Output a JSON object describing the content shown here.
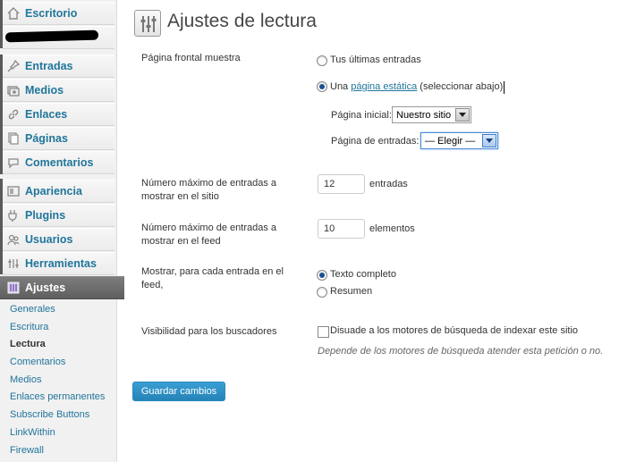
{
  "sidebar": {
    "items": [
      {
        "label": "Escritorio",
        "icon": "dashboard-icon"
      },
      {
        "label": "",
        "icon": "redacted"
      },
      {
        "label": "Entradas",
        "icon": "pin-icon"
      },
      {
        "label": "Medios",
        "icon": "media-icon"
      },
      {
        "label": "Enlaces",
        "icon": "links-icon"
      },
      {
        "label": "Páginas",
        "icon": "pages-icon"
      },
      {
        "label": "Comentarios",
        "icon": "comments-icon"
      },
      {
        "label": "Apariencia",
        "icon": "appearance-icon"
      },
      {
        "label": "Plugins",
        "icon": "plugins-icon"
      },
      {
        "label": "Usuarios",
        "icon": "users-icon"
      },
      {
        "label": "Herramientas",
        "icon": "tools-icon"
      },
      {
        "label": "Ajustes",
        "icon": "settings-icon"
      }
    ],
    "submenu": [
      "Generales",
      "Escritura",
      "Lectura",
      "Comentarios",
      "Medios",
      "Enlaces permanentes",
      "Subscribe Buttons",
      "LinkWithin",
      "Firewall"
    ],
    "active_submenu": "Lectura"
  },
  "main": {
    "title": "Ajustes de lectura",
    "front_page": {
      "label": "Página frontal muestra",
      "option_latest": "Tus últimas entradas",
      "option_static_prefix": "Una ",
      "option_static_link": "página estática",
      "option_static_suffix": " (seleccionar abajo)",
      "selected": "static",
      "home_label": "Página inicial:",
      "home_value": "Nuestro sitio",
      "posts_label": "Página de entradas:",
      "posts_value": "— Elegir —"
    },
    "posts_per_page": {
      "label_line1": "Número máximo de entradas a",
      "label_line2": "mostrar en el sitio",
      "value": "12",
      "unit": "entradas"
    },
    "posts_per_rss": {
      "label_line1": "Número máximo de entradas a",
      "label_line2": "mostrar en el feed",
      "value": "10",
      "unit": "elementos"
    },
    "rss_use_excerpt": {
      "label_line1": "Mostrar, para cada entrada en el",
      "label_line2": "feed,",
      "option_full": "Texto completo",
      "option_summary": "Resumen",
      "selected": "full"
    },
    "visibility": {
      "label": "Visibilidad para los buscadores",
      "checkbox_label": "Disuade a los motores de búsqueda de indexar este sitio",
      "checked": false,
      "description": "Depende de los motores de búsqueda atender esta petición o no."
    },
    "save_button": "Guardar cambios"
  },
  "colors": {
    "link": "#21759b",
    "primary_button": "#2583b7",
    "active_menu_bg": "#6d6d6d"
  }
}
